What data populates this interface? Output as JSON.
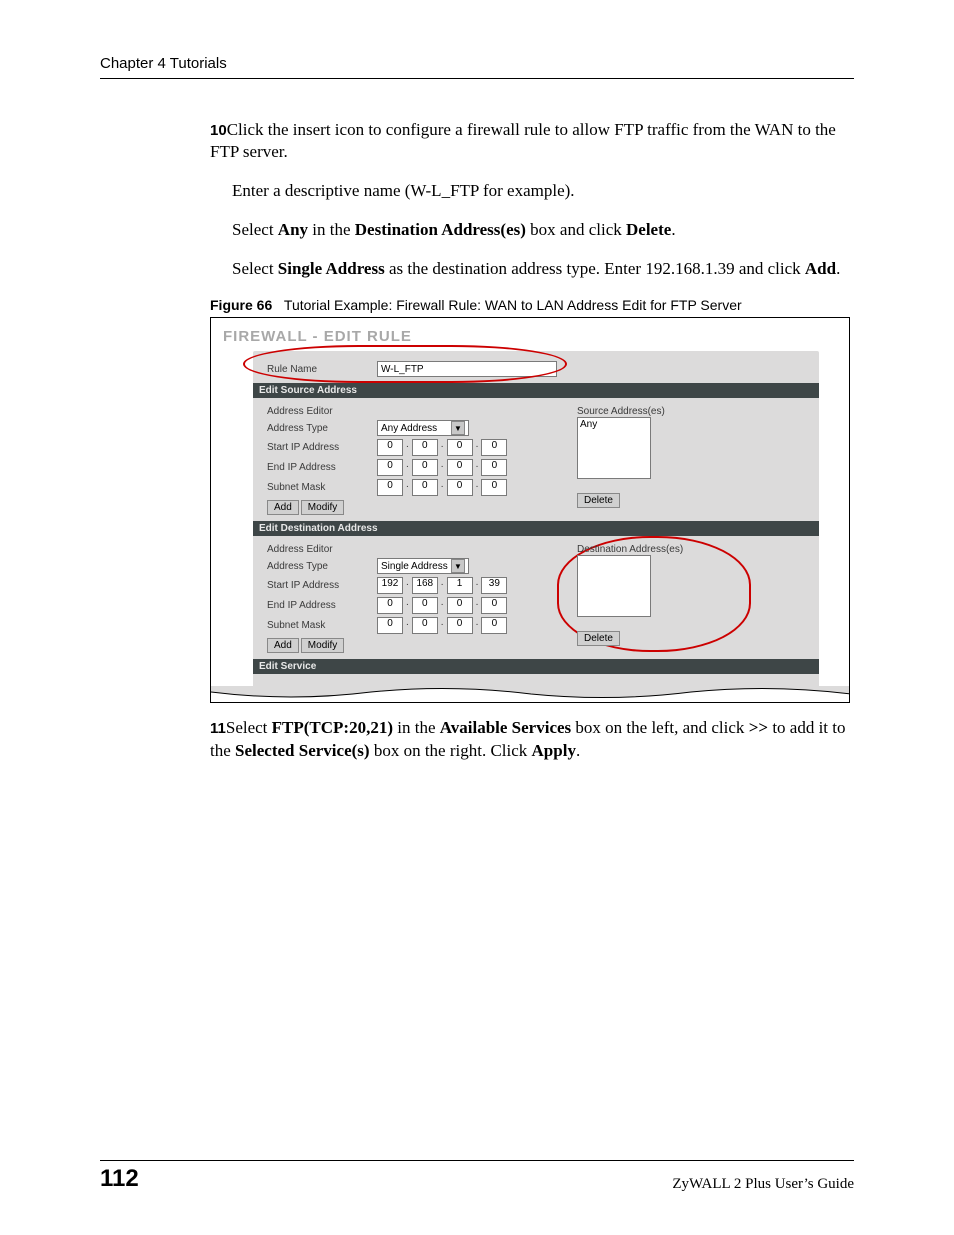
{
  "header": {
    "chapter": "Chapter 4 Tutorials"
  },
  "step10": {
    "num": "10",
    "main": "Click the insert icon to configure a firewall rule to allow FTP traffic from the WAN to the FTP server.",
    "line_a": "Enter a descriptive name (W-L_FTP for example).",
    "line_b_pre": "Select ",
    "line_b_b1": "Any",
    "line_b_mid": " in the ",
    "line_b_b2": "Destination Address(es)",
    "line_b_mid2": " box and click ",
    "line_b_b3": "Delete",
    "line_b_end": ".",
    "line_c_pre": "Select ",
    "line_c_b1": "Single Address",
    "line_c_mid": " as the destination address type. Enter 192.168.1.39 and click ",
    "line_c_b2": "Add",
    "line_c_end": "."
  },
  "figure": {
    "label": "Figure 66",
    "caption": "Tutorial Example: Firewall Rule: WAN to LAN Address Edit for FTP Server"
  },
  "shot": {
    "title": "FIREWALL - EDIT RULE",
    "rule_name_label": "Rule Name",
    "rule_name_value": "W-L_FTP",
    "sec_src": "Edit Source Address",
    "sec_dst": "Edit Destination Address",
    "sec_srv": "Edit Service",
    "addr_editor": "Address Editor",
    "addr_type": "Address Type",
    "start_ip": "Start IP Address",
    "end_ip": "End IP Address",
    "subnet": "Subnet Mask",
    "src_type_value": "Any Address",
    "dst_type_value": "Single Address",
    "src_list_label": "Source Address(es)",
    "dst_list_label": "Destination Address(es)",
    "src_list_value": "Any",
    "btn_add": "Add",
    "btn_modify": "Modify",
    "btn_delete": "Delete",
    "src_start": [
      "0",
      "0",
      "0",
      "0"
    ],
    "src_end": [
      "0",
      "0",
      "0",
      "0"
    ],
    "src_mask": [
      "0",
      "0",
      "0",
      "0"
    ],
    "dst_start": [
      "192",
      "168",
      "1",
      "39"
    ],
    "dst_end": [
      "0",
      "0",
      "0",
      "0"
    ],
    "dst_mask": [
      "0",
      "0",
      "0",
      "0"
    ]
  },
  "step11": {
    "num": "11",
    "pre": "Select ",
    "b1": "FTP(TCP:20,21)",
    "mid1": " in the ",
    "b2": "Available Services",
    "mid2": " box on the left, and click ",
    "b3": ">>",
    "mid3": " to add it to the ",
    "b4": "Selected Service(s)",
    "mid4": " box on the right. Click ",
    "b5": "Apply",
    "end": "."
  },
  "footer": {
    "page": "112",
    "guide": "ZyWALL 2 Plus User’s Guide"
  }
}
